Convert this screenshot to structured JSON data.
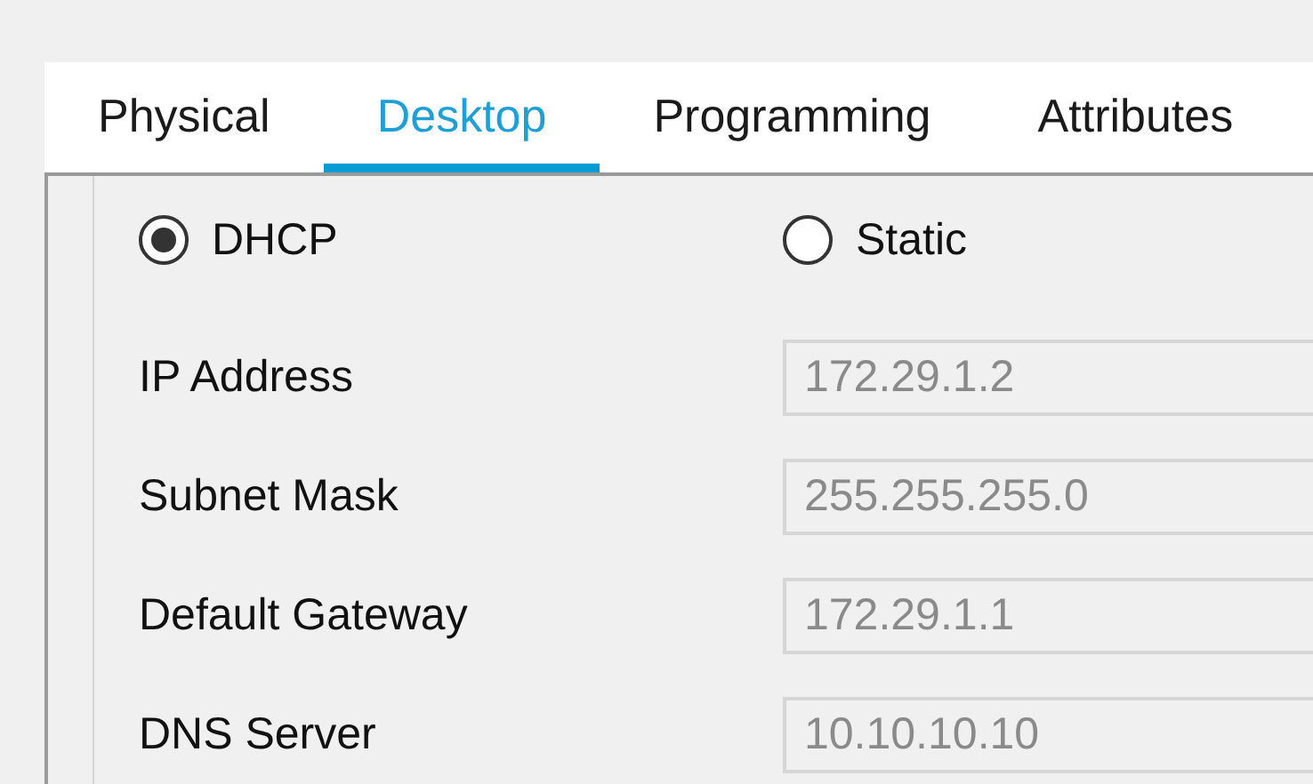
{
  "tabs": [
    {
      "label": "Physical",
      "selected": false
    },
    {
      "label": "Desktop",
      "selected": true
    },
    {
      "label": "Programming",
      "selected": false
    },
    {
      "label": "Attributes",
      "selected": false
    }
  ],
  "ip_mode": [
    {
      "label": "DHCP",
      "selected": true
    },
    {
      "label": "Static",
      "selected": false
    }
  ],
  "fields": [
    {
      "label": "IP Address",
      "value": "172.29.1.2",
      "disabled": true
    },
    {
      "label": "Subnet Mask",
      "value": "255.255.255.0",
      "disabled": true
    },
    {
      "label": "Default Gateway",
      "value": "172.29.1.1",
      "disabled": true
    },
    {
      "label": "DNS Server",
      "value": "10.10.10.10",
      "disabled": true
    }
  ]
}
